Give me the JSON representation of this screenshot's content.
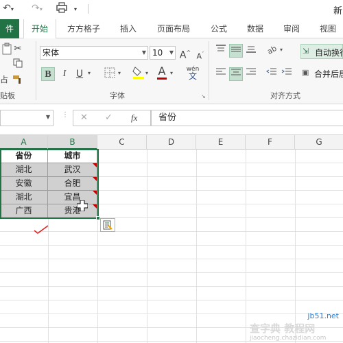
{
  "title_partial": "新",
  "tabs": [
    {
      "label": "件"
    },
    {
      "label": "开始"
    },
    {
      "label": "方方格子"
    },
    {
      "label": "插入"
    },
    {
      "label": "页面布局"
    },
    {
      "label": "公式"
    },
    {
      "label": "数据"
    },
    {
      "label": "审阅"
    },
    {
      "label": "视图"
    }
  ],
  "ribbon": {
    "clipboard": {
      "label": "贴板",
      "paste_partial": "占"
    },
    "font": {
      "label": "字体",
      "font_name": "宋体",
      "font_size": "10",
      "bold": "B",
      "italic": "I",
      "underline": "U",
      "grow": "A",
      "shrink": "A",
      "wen": "wén",
      "wen_char": "文"
    },
    "alignment": {
      "label": "对齐方式",
      "wrap_text": "自动换行",
      "merge_center": "合并后居"
    }
  },
  "formula_bar": {
    "fx": "fx",
    "cancel": "✕",
    "enter": "✓",
    "content": "省份"
  },
  "columns": [
    "A",
    "B",
    "C",
    "D",
    "E",
    "F",
    "G"
  ],
  "table": {
    "header": [
      "省份",
      "城市"
    ],
    "rows": [
      [
        "湖北",
        "武汉"
      ],
      [
        "安徽",
        "合肥"
      ],
      [
        "湖北",
        "宜昌"
      ],
      [
        "广西",
        "贵港"
      ]
    ]
  },
  "watermark": {
    "line1": "jb51.net",
    "line2": "查字典 教程网",
    "line3": "jiaocheng.chazidian.com"
  },
  "colors": {
    "accent": "#217346",
    "comment_marker": "#c00000",
    "selection": "#217346"
  }
}
